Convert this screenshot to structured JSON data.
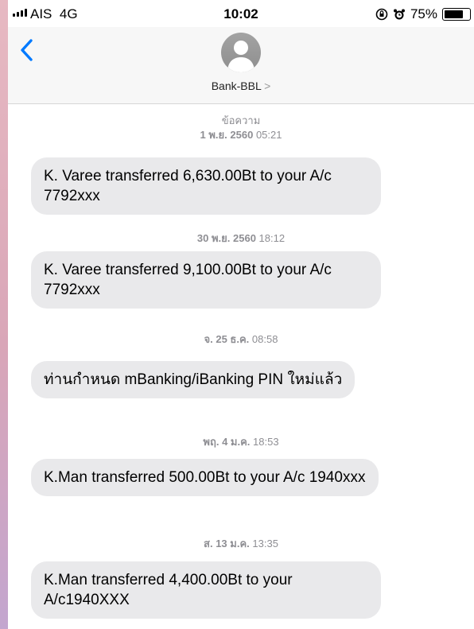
{
  "status_bar": {
    "carrier": "AIS",
    "network": "4G",
    "time": "10:02",
    "battery_percent": "75%",
    "battery_level": 0.75
  },
  "header": {
    "contact_name": "Bank-BBL",
    "chevron": ">",
    "back_icon": "chevron-left-icon"
  },
  "thread": {
    "first_label": "ข้อความ",
    "groups": [
      {
        "date": "1 พ.ย. 2560",
        "time": "05:21",
        "text": "K. Varee transferred 6,630.00Bt to your A/c 7792xxx"
      },
      {
        "date": "30 พ.ย. 2560",
        "time": "18:12",
        "text": "K. Varee transferred 9,100.00Bt to your A/c 7792xxx"
      },
      {
        "date": "จ. 25 ธ.ค.",
        "time": "08:58",
        "text": "ท่านกำหนด mBanking/iBanking PIN ใหม่แล้ว"
      },
      {
        "date": "พฤ. 4 ม.ค.",
        "time": "18:53",
        "text": "K.Man  transferred 500.00Bt to your A/c 1940xxx"
      },
      {
        "date": "ส. 13 ม.ค.",
        "time": "13:35",
        "text": "K.Man  transferred 4,400.00Bt to your A/c1940XXX"
      }
    ]
  },
  "colors": {
    "accent": "#007aff",
    "bubble": "#e9e9eb",
    "header_bg": "#f7f7f7",
    "timestamp": "#8e8e93"
  }
}
